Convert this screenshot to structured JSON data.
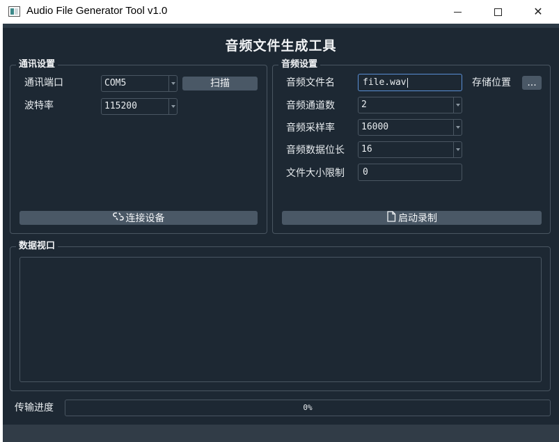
{
  "window": {
    "title": "Audio File Generator Tool v1.0",
    "minimize_glyph": "",
    "close_glyph": "✕"
  },
  "main_title": "音频文件生成工具",
  "comm": {
    "group_label": "通讯设置",
    "port_label": "通讯端口",
    "port_value": "COM5",
    "scan_label": "扫描",
    "baud_label": "波特率",
    "baud_value": "115200",
    "connect_label": "连接设备",
    "connect_icon": "unlink-icon"
  },
  "audio": {
    "group_label": "音频设置",
    "filename_label": "音频文件名",
    "filename_value": "file.wav",
    "storage_label": "存储位置",
    "browse_label": "...",
    "channels_label": "音频通道数",
    "channels_value": "2",
    "samplerate_label": "音频采样率",
    "samplerate_value": "16000",
    "bitdepth_label": "音频数据位长",
    "bitdepth_value": "16",
    "sizelimit_label": "文件大小限制",
    "sizelimit_value": "0",
    "record_label": "启动录制",
    "record_icon": "document-icon"
  },
  "data_view": {
    "group_label": "数据视口"
  },
  "progress": {
    "label": "传输进度",
    "value": 0,
    "text": "0%"
  },
  "colors": {
    "background": "#1d2833",
    "button": "#4a5866",
    "border": "#4a5662",
    "focus": "#5a8fd6"
  }
}
